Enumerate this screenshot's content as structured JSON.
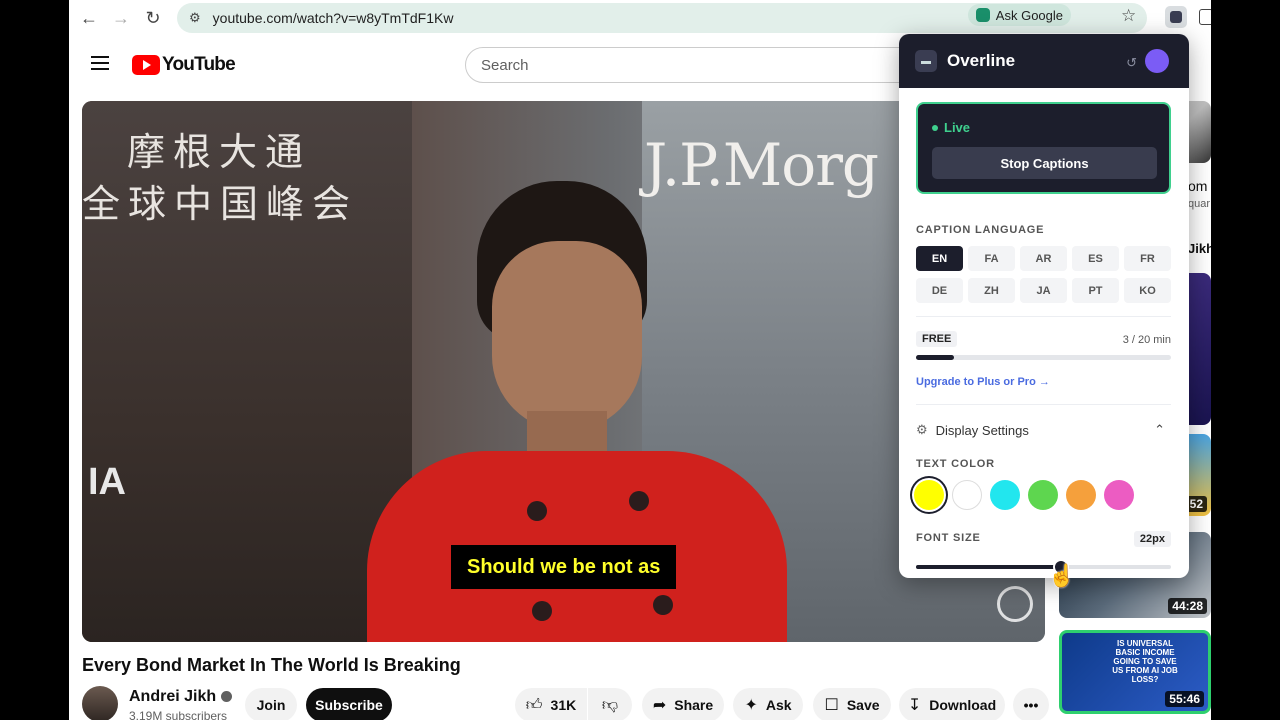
{
  "browser": {
    "url": "youtube.com/watch?v=w8yTmTdF1Kw",
    "ask_google": "Ask Google"
  },
  "youtube": {
    "logo_text": "YouTube",
    "search_placeholder": "Search"
  },
  "video": {
    "sign_chinese_line1": "摩根大通",
    "sign_chinese_line2": "全球中国峰会",
    "sign_brand": "J.P.Morg",
    "sign_left": "IA",
    "caption": "Should we be not as",
    "title": "Every Bond Market In The World Is Breaking"
  },
  "channel": {
    "name": "Andrei Jikh",
    "subscribers": "3.19M subscribers",
    "join_label": "Join",
    "subscribe_label": "Subscribe"
  },
  "actions": {
    "like_count": "31K",
    "share_label": "Share",
    "ask_label": "Ask",
    "save_label": "Save",
    "download_label": "Download"
  },
  "sidebar": {
    "durations": [
      "44:28",
      "55:46"
    ],
    "partial_duration": ":52",
    "partial_texts": [
      "om",
      "quar",
      "Jikh"
    ],
    "thumb_caption": "IS UNIVERSAL BASIC INCOME GOING TO SAVE US FROM AI JOB LOSS?"
  },
  "extension": {
    "name": "Overline",
    "status": "Live",
    "stop_button": "Stop Captions",
    "caption_language_label": "CAPTION LANGUAGE",
    "languages": [
      "EN",
      "FA",
      "AR",
      "ES",
      "FR",
      "DE",
      "ZH",
      "JA",
      "PT",
      "KO"
    ],
    "selected_language": "EN",
    "plan_badge": "FREE",
    "usage_text": "3 / 20 min",
    "usage_fraction": 0.15,
    "upgrade_link": "Upgrade to Plus or Pro →",
    "display_settings_label": "Display Settings",
    "text_color_label": "TEXT COLOR",
    "text_colors": [
      "#ffff00",
      "#ffffff",
      "#22e6ee",
      "#5ed64f",
      "#f5a03c",
      "#ec5cc2"
    ],
    "selected_color": "#ffff00",
    "font_size_label": "FONT SIZE",
    "font_size_value": "22px",
    "font_size_fraction": 0.57
  }
}
